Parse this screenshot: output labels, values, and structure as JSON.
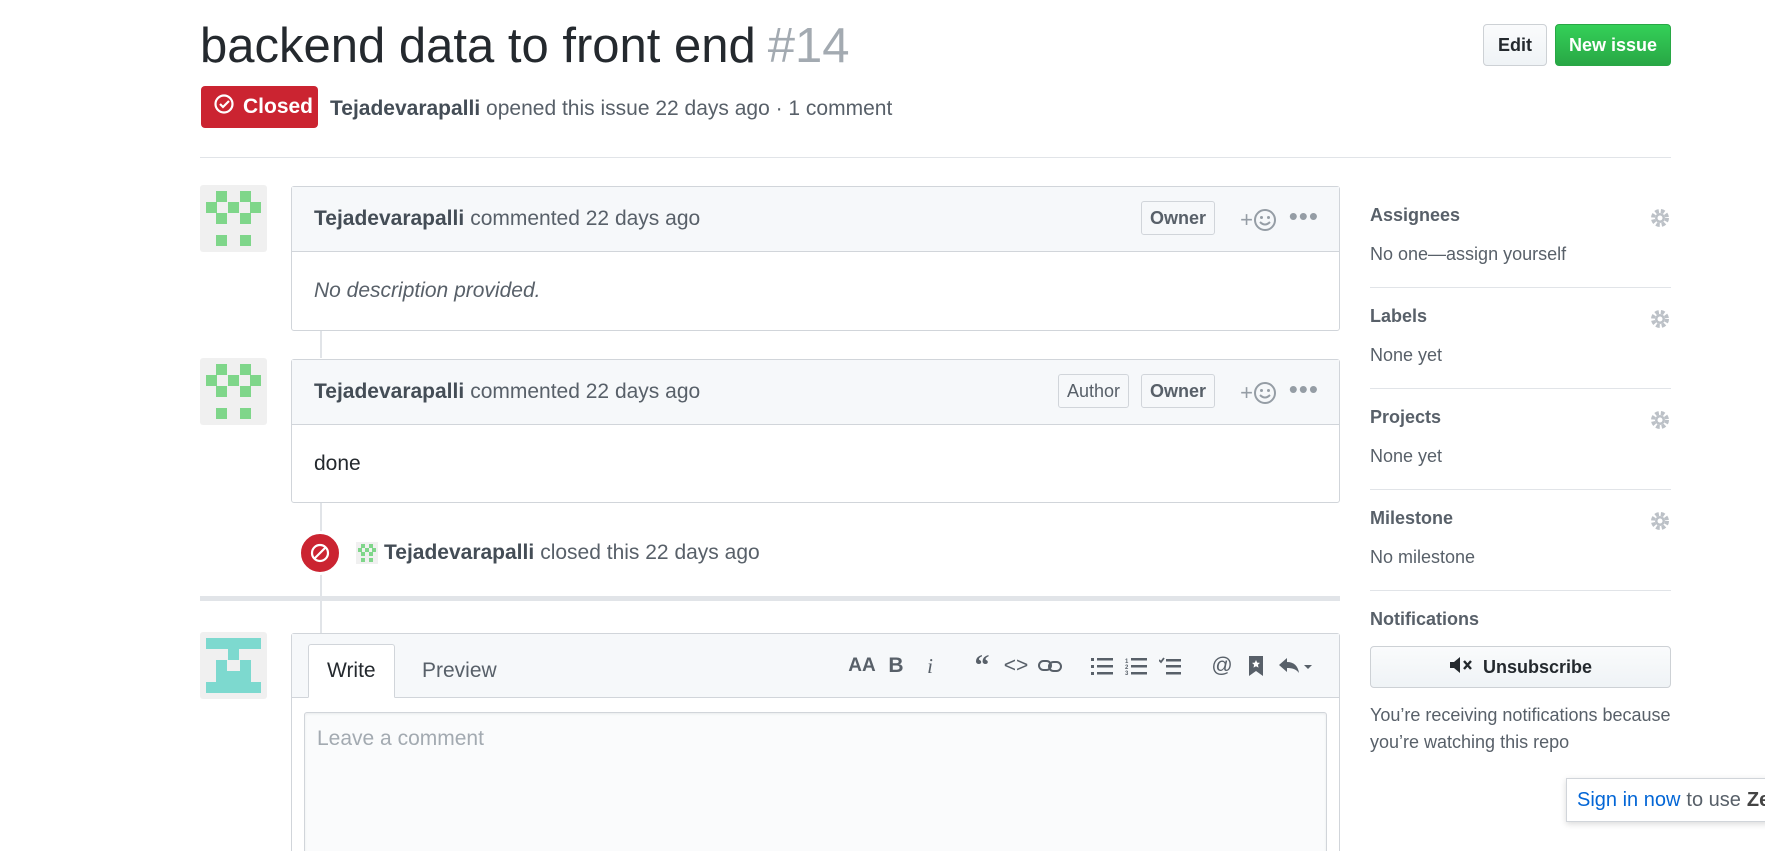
{
  "issue": {
    "title": "backend data to front end",
    "number": "#14",
    "state": "Closed",
    "author": "Tejadevarapalli",
    "meta_text": "opened this issue 22 days ago · 1 comment"
  },
  "header": {
    "edit_label": "Edit",
    "new_issue_label": "New issue"
  },
  "comments": [
    {
      "author": "Tejadevarapalli",
      "action": "commented 22 days ago",
      "badges": [
        "Owner"
      ],
      "body": "No description provided."
    },
    {
      "author": "Tejadevarapalli",
      "action": "commented 22 days ago",
      "badges": [
        "Author",
        "Owner"
      ],
      "body": "done"
    }
  ],
  "close_event": {
    "author": "Tejadevarapalli",
    "text": "closed this 22 days ago"
  },
  "editor": {
    "tab_write": "Write",
    "tab_preview": "Preview",
    "placeholder": "Leave a comment"
  },
  "sidebar": {
    "assignees": {
      "title": "Assignees",
      "value": "No one—assign yourself"
    },
    "labels": {
      "title": "Labels",
      "value": "None yet"
    },
    "projects": {
      "title": "Projects",
      "value": "None yet"
    },
    "milestone": {
      "title": "Milestone",
      "value": "No milestone"
    },
    "notifications": {
      "title": "Notifications",
      "button": "Unsubscribe",
      "text": "You’re receiving notifications because you’re watching this repo"
    }
  },
  "signin_popup": {
    "link": "Sign in now",
    "text": "to use",
    "trailing": "Ze"
  },
  "colors": {
    "closed_red": "#cb2431",
    "new_issue_green": "#28a745",
    "avatar_green": "#7fd68a",
    "avatar_teal": "#7dd9cf"
  }
}
